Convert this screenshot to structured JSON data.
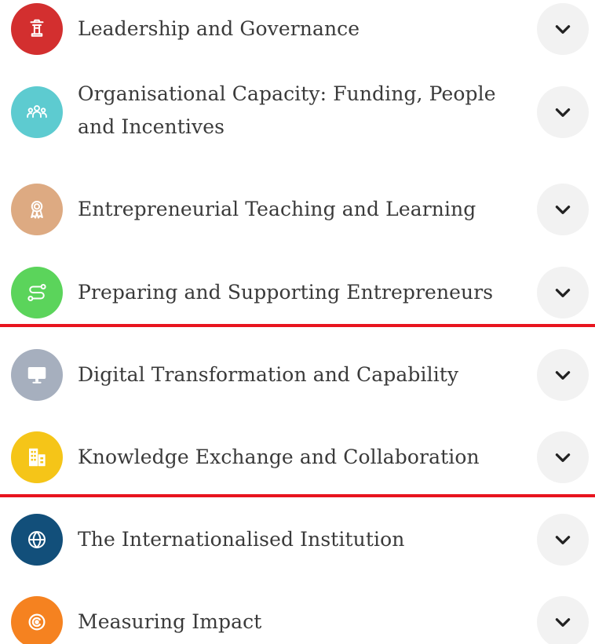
{
  "items": [
    {
      "label": "Leadership and Governance",
      "icon": "podium-icon",
      "color": "#d32f2f"
    },
    {
      "label": "Organisational Capacity: Funding, People and Incentives",
      "icon": "people-icon",
      "color": "#5dcbd0"
    },
    {
      "label": "Entrepreneurial Teaching and Learning",
      "icon": "award-ribbon-icon",
      "color": "#ddaa82"
    },
    {
      "label": "Preparing and Supporting Entrepreneurs",
      "icon": "route-icon",
      "color": "#5bd45b"
    },
    {
      "label": "Digital Transformation and Capability",
      "icon": "monitor-icon",
      "color": "#a6afbe"
    },
    {
      "label": "Knowledge Exchange and Collaboration",
      "icon": "buildings-icon",
      "color": "#f5c518"
    },
    {
      "label": "The Internationalised Institution",
      "icon": "globe-icon",
      "color": "#124f7a"
    },
    {
      "label": "Measuring Impact",
      "icon": "target-icon",
      "color": "#f58220"
    }
  ],
  "toggle_icon": "chevron-down-icon",
  "divider_color": "#e8141e"
}
